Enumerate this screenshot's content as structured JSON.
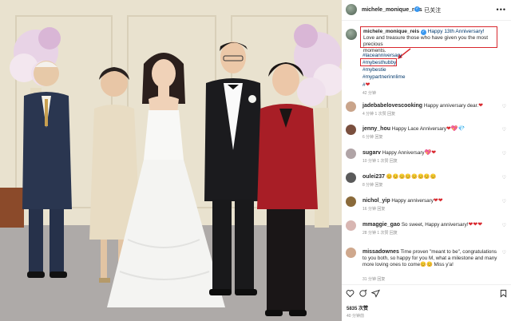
{
  "post": {
    "username": "michele_monique_reis",
    "verified_badge": "✓",
    "follow_status": "· 已关注",
    "more": "•••",
    "caption": {
      "username": "michele_monique_reis",
      "line1": " Happy 13th Anniversary!",
      "line2": "Love and treasure those who have given you the most precious",
      "line3": "moments."
    },
    "hashtags": [
      "#laceanniversary",
      "#mybesthubby",
      "#mybestie",
      "#mypartnerinnlime",
      "#"
    ],
    "heart": "❤",
    "caption_time": "42 分钟",
    "likes": "5835 次赞",
    "date": "40 分钟前"
  },
  "comments": [
    {
      "user": "jadebabelovescooking",
      "text": "Happy anniversary dear.",
      "emoji": "❤",
      "meta": "4 分钟  1 次赞  回复"
    },
    {
      "user": "jenny_hou",
      "text": "Happy Lace Anniversary",
      "emoji": "❤💖💎",
      "meta": "6 分钟  回复"
    },
    {
      "user": "sugarv",
      "text": "Happy Anniversary",
      "emoji": "💖❤",
      "meta": "10 分钟  1 次赞  回复"
    },
    {
      "user": "oulei237",
      "text": "",
      "emoji": "😊😊😊😊😊😊😊😊",
      "meta": "8 分钟  回复"
    },
    {
      "user": "nichol_yip",
      "text": "Happy anniversary",
      "emoji": "❤❤",
      "meta": "16 分钟  回复"
    },
    {
      "user": "mmaggie_gao",
      "text": "So sweet, Happy anniversary!",
      "emoji": "❤❤❤",
      "meta": "28 分钟  1 次赞  回复"
    },
    {
      "user": "missadownes",
      "text": "Time proven \"meant to be\", congratulations to you both, so happy for you M, what a milestone and many more loving ones to come",
      "emoji": "😊😊",
      "extra": " Miss y'a!",
      "meta": "31 分钟  回复"
    }
  ],
  "colors": {
    "highlight_red": "#d8272d",
    "link_blue": "#00376b",
    "verified_blue": "#3897f0",
    "meta_gray": "#8e8e8e"
  },
  "icons": [
    "heart-icon",
    "comment-icon",
    "share-icon",
    "bookmark-icon"
  ]
}
